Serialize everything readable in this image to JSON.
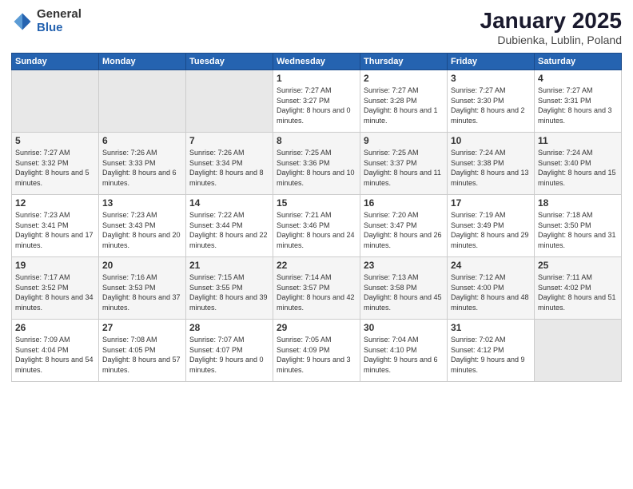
{
  "logo": {
    "general": "General",
    "blue": "Blue"
  },
  "title": "January 2025",
  "subtitle": "Dubienka, Lublin, Poland",
  "days_of_week": [
    "Sunday",
    "Monday",
    "Tuesday",
    "Wednesday",
    "Thursday",
    "Friday",
    "Saturday"
  ],
  "weeks": [
    [
      {
        "day": "",
        "empty": true
      },
      {
        "day": "",
        "empty": true
      },
      {
        "day": "",
        "empty": true
      },
      {
        "day": "1",
        "sunrise": "7:27 AM",
        "sunset": "3:27 PM",
        "daylight": "8 hours and 0 minutes."
      },
      {
        "day": "2",
        "sunrise": "7:27 AM",
        "sunset": "3:28 PM",
        "daylight": "8 hours and 1 minute."
      },
      {
        "day": "3",
        "sunrise": "7:27 AM",
        "sunset": "3:30 PM",
        "daylight": "8 hours and 2 minutes."
      },
      {
        "day": "4",
        "sunrise": "7:27 AM",
        "sunset": "3:31 PM",
        "daylight": "8 hours and 3 minutes."
      }
    ],
    [
      {
        "day": "5",
        "sunrise": "7:27 AM",
        "sunset": "3:32 PM",
        "daylight": "8 hours and 5 minutes."
      },
      {
        "day": "6",
        "sunrise": "7:26 AM",
        "sunset": "3:33 PM",
        "daylight": "8 hours and 6 minutes."
      },
      {
        "day": "7",
        "sunrise": "7:26 AM",
        "sunset": "3:34 PM",
        "daylight": "8 hours and 8 minutes."
      },
      {
        "day": "8",
        "sunrise": "7:25 AM",
        "sunset": "3:36 PM",
        "daylight": "8 hours and 10 minutes."
      },
      {
        "day": "9",
        "sunrise": "7:25 AM",
        "sunset": "3:37 PM",
        "daylight": "8 hours and 11 minutes."
      },
      {
        "day": "10",
        "sunrise": "7:24 AM",
        "sunset": "3:38 PM",
        "daylight": "8 hours and 13 minutes."
      },
      {
        "day": "11",
        "sunrise": "7:24 AM",
        "sunset": "3:40 PM",
        "daylight": "8 hours and 15 minutes."
      }
    ],
    [
      {
        "day": "12",
        "sunrise": "7:23 AM",
        "sunset": "3:41 PM",
        "daylight": "8 hours and 17 minutes."
      },
      {
        "day": "13",
        "sunrise": "7:23 AM",
        "sunset": "3:43 PM",
        "daylight": "8 hours and 20 minutes."
      },
      {
        "day": "14",
        "sunrise": "7:22 AM",
        "sunset": "3:44 PM",
        "daylight": "8 hours and 22 minutes."
      },
      {
        "day": "15",
        "sunrise": "7:21 AM",
        "sunset": "3:46 PM",
        "daylight": "8 hours and 24 minutes."
      },
      {
        "day": "16",
        "sunrise": "7:20 AM",
        "sunset": "3:47 PM",
        "daylight": "8 hours and 26 minutes."
      },
      {
        "day": "17",
        "sunrise": "7:19 AM",
        "sunset": "3:49 PM",
        "daylight": "8 hours and 29 minutes."
      },
      {
        "day": "18",
        "sunrise": "7:18 AM",
        "sunset": "3:50 PM",
        "daylight": "8 hours and 31 minutes."
      }
    ],
    [
      {
        "day": "19",
        "sunrise": "7:17 AM",
        "sunset": "3:52 PM",
        "daylight": "8 hours and 34 minutes."
      },
      {
        "day": "20",
        "sunrise": "7:16 AM",
        "sunset": "3:53 PM",
        "daylight": "8 hours and 37 minutes."
      },
      {
        "day": "21",
        "sunrise": "7:15 AM",
        "sunset": "3:55 PM",
        "daylight": "8 hours and 39 minutes."
      },
      {
        "day": "22",
        "sunrise": "7:14 AM",
        "sunset": "3:57 PM",
        "daylight": "8 hours and 42 minutes."
      },
      {
        "day": "23",
        "sunrise": "7:13 AM",
        "sunset": "3:58 PM",
        "daylight": "8 hours and 45 minutes."
      },
      {
        "day": "24",
        "sunrise": "7:12 AM",
        "sunset": "4:00 PM",
        "daylight": "8 hours and 48 minutes."
      },
      {
        "day": "25",
        "sunrise": "7:11 AM",
        "sunset": "4:02 PM",
        "daylight": "8 hours and 51 minutes."
      }
    ],
    [
      {
        "day": "26",
        "sunrise": "7:09 AM",
        "sunset": "4:04 PM",
        "daylight": "8 hours and 54 minutes."
      },
      {
        "day": "27",
        "sunrise": "7:08 AM",
        "sunset": "4:05 PM",
        "daylight": "8 hours and 57 minutes."
      },
      {
        "day": "28",
        "sunrise": "7:07 AM",
        "sunset": "4:07 PM",
        "daylight": "9 hours and 0 minutes."
      },
      {
        "day": "29",
        "sunrise": "7:05 AM",
        "sunset": "4:09 PM",
        "daylight": "9 hours and 3 minutes."
      },
      {
        "day": "30",
        "sunrise": "7:04 AM",
        "sunset": "4:10 PM",
        "daylight": "9 hours and 6 minutes."
      },
      {
        "day": "31",
        "sunrise": "7:02 AM",
        "sunset": "4:12 PM",
        "daylight": "9 hours and 9 minutes."
      },
      {
        "day": "",
        "empty": true
      }
    ]
  ]
}
